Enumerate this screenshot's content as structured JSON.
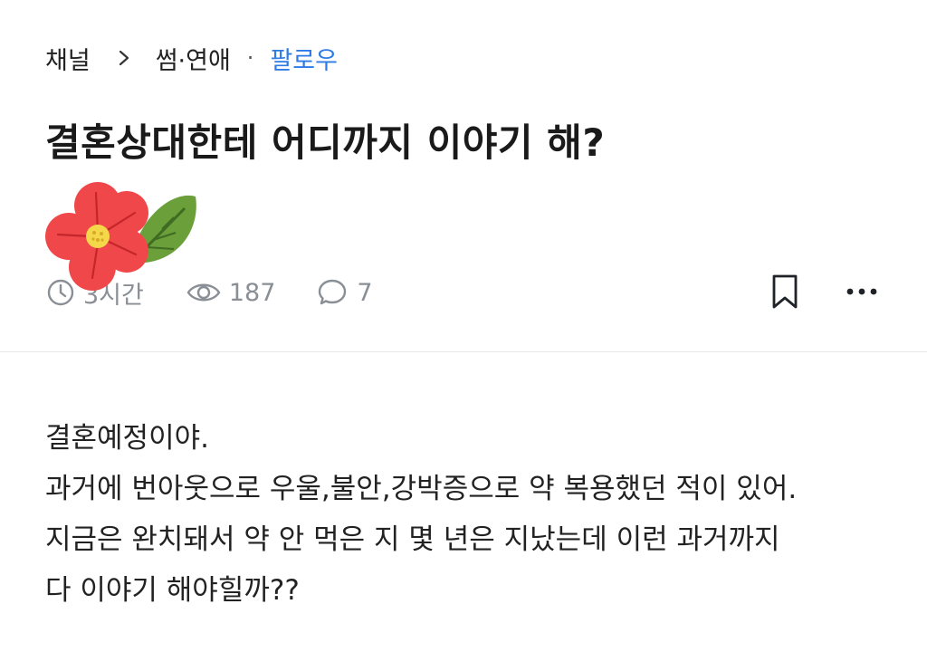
{
  "breadcrumb": {
    "channel": "채널",
    "category": "썸·연애",
    "separator_dot": "·",
    "follow_label": "팔로우"
  },
  "post": {
    "title": "결혼상대한테 어디까지 이야기 해?",
    "time_ago": "3시간",
    "views": "187",
    "comments": "7",
    "body_lines": [
      "결혼예정이야.",
      "과거에 번아웃으로 우울,불안,강박증으로 약 복용했던 적이 있어.",
      "지금은 완치돼서 약 안 먹은 지 몇 년은 지났는데 이런 과거까지",
      "다 이야기 해야힐까??"
    ]
  },
  "icons": {
    "chevron": "chevron-right-icon",
    "clock": "clock-icon",
    "eye": "eye-icon",
    "comment": "comment-bubble-icon",
    "bookmark": "bookmark-icon",
    "more": "more-horizontal-icon",
    "sticker": "flower-sticker"
  },
  "colors": {
    "follow": "#2f7be5",
    "meta": "#8a8f96",
    "flower_petal": "#f0484a",
    "flower_center": "#f5d84a",
    "leaf": "#6a9f3a"
  }
}
